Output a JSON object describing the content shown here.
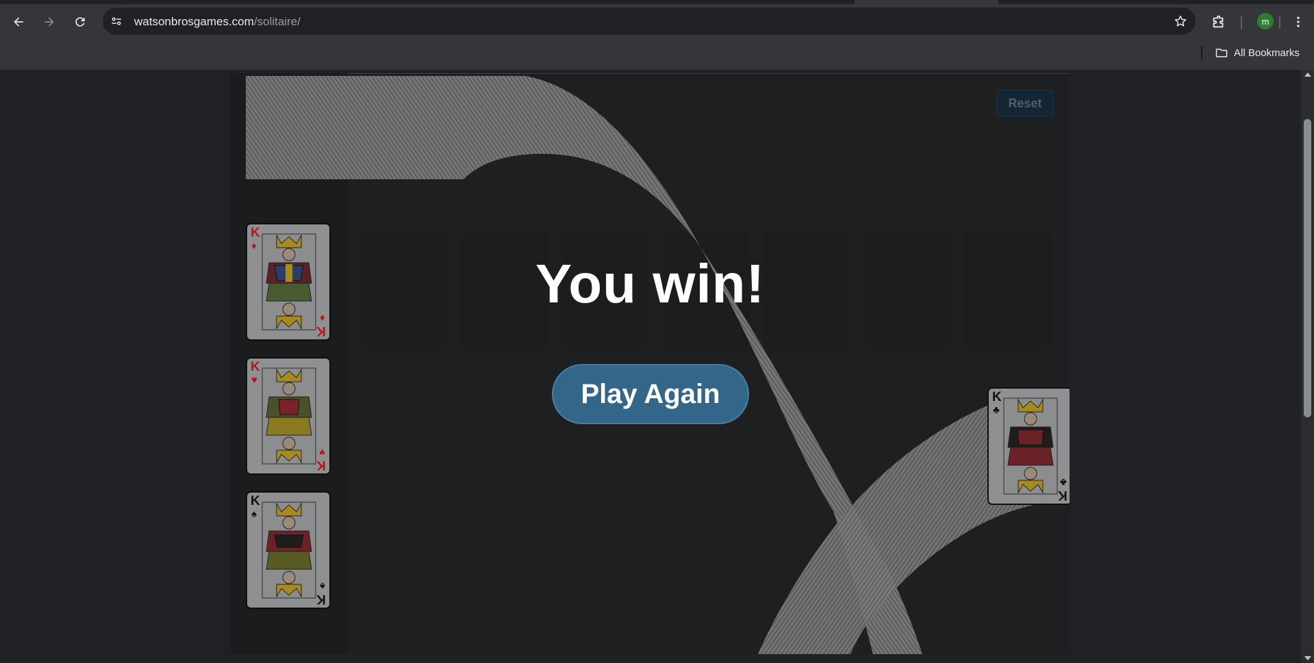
{
  "browser": {
    "url_host": "watsonbrosgames.com",
    "url_path": "/solitaire/",
    "profile_initial": "m",
    "bookmarks_label": "All Bookmarks"
  },
  "game": {
    "reset_label": "Reset",
    "win_message": "You win!",
    "play_again_label": "Play Again",
    "foundation_cards": [
      {
        "rank": "K",
        "suit": "♦",
        "color": "red",
        "name": "king-of-diamonds"
      },
      {
        "rank": "K",
        "suit": "♥",
        "color": "red",
        "name": "king-of-hearts"
      },
      {
        "rank": "K",
        "suit": "♠",
        "color": "black",
        "name": "king-of-spades"
      }
    ],
    "bouncing_card": {
      "rank": "K",
      "suit": "♣",
      "color": "black",
      "name": "king-of-clubs"
    }
  }
}
